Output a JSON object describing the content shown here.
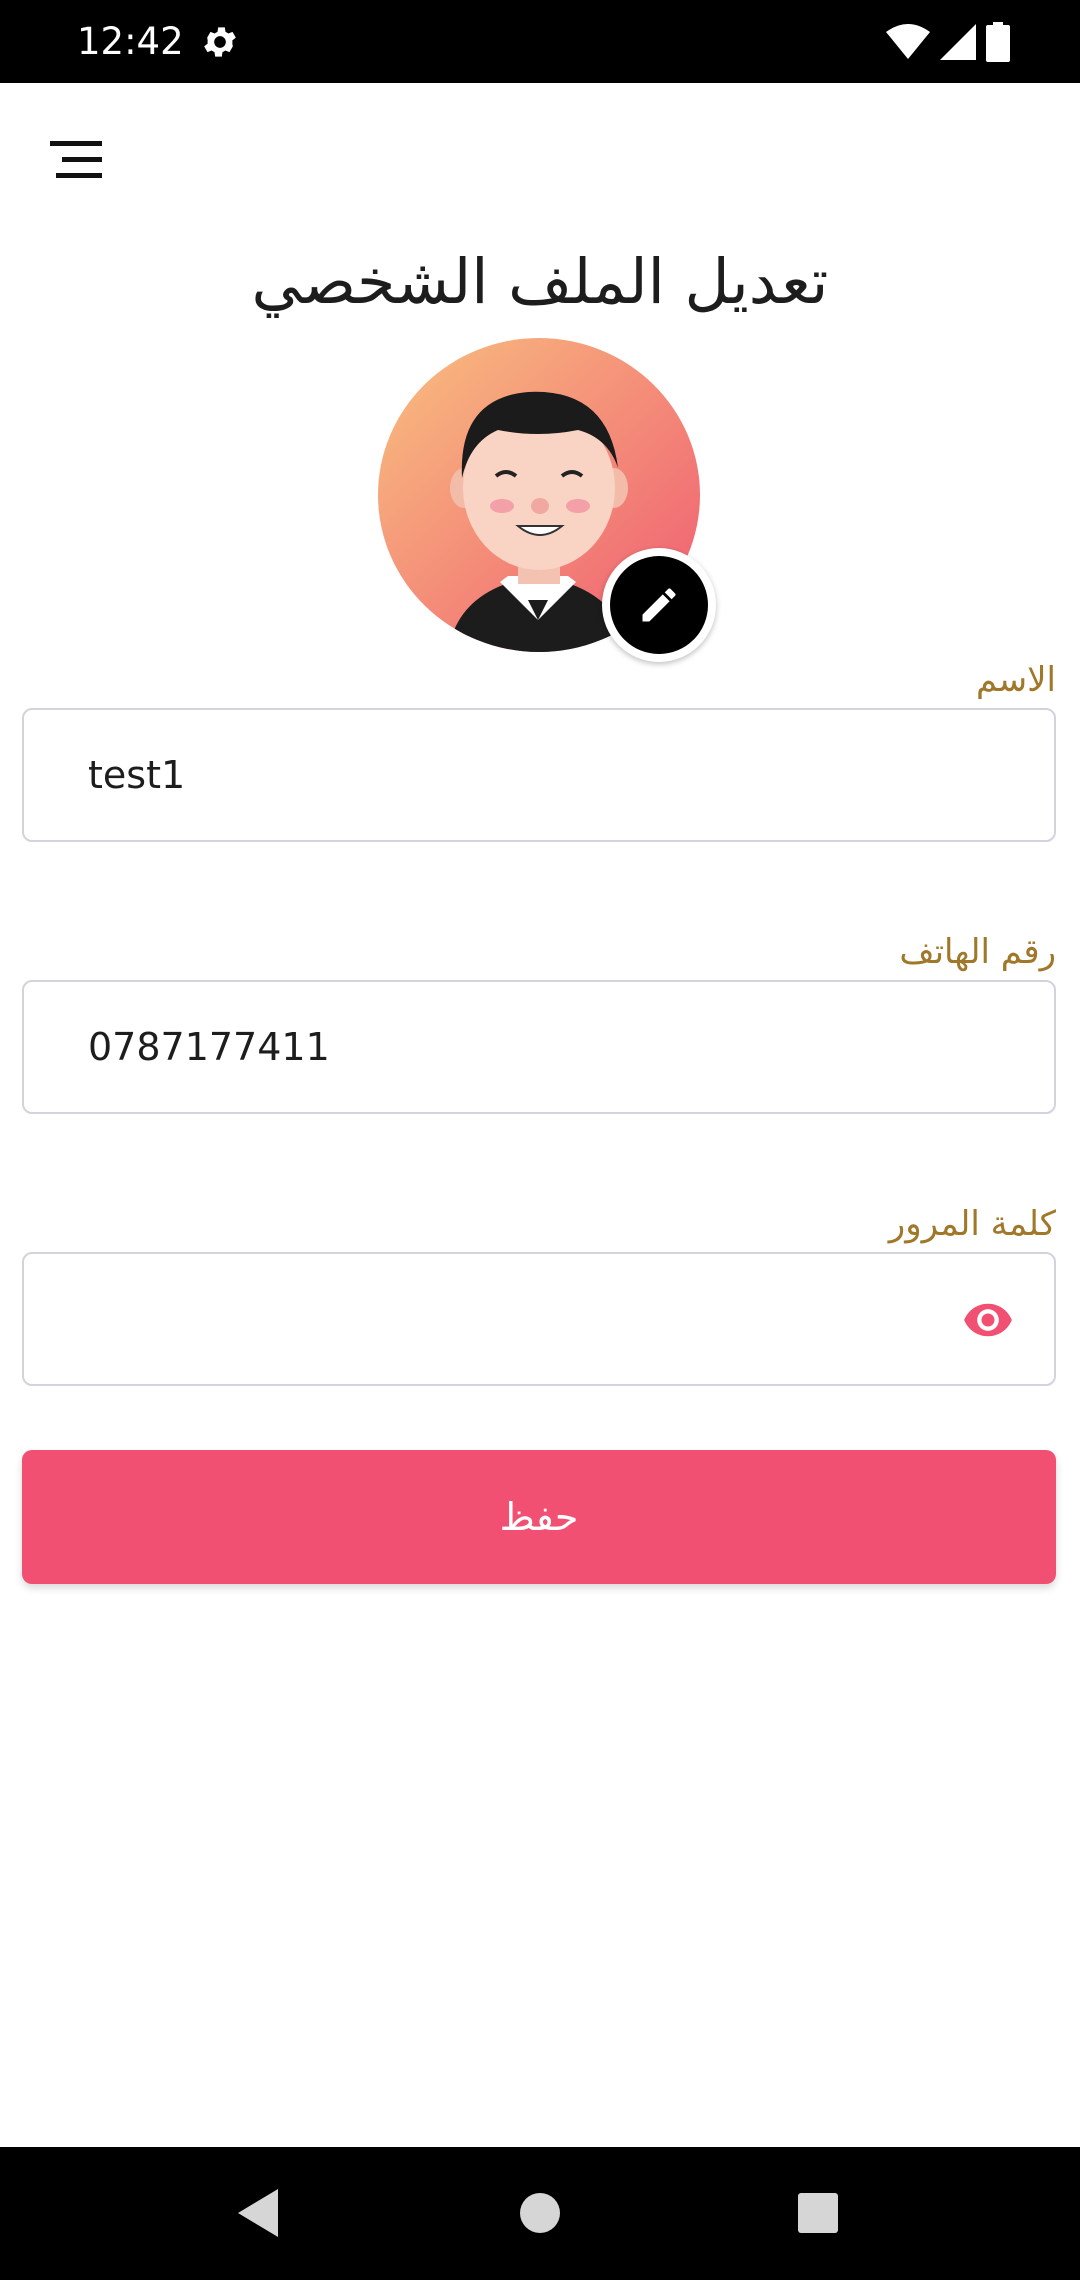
{
  "status_bar": {
    "time": "12:42",
    "icons": [
      "settings-icon",
      "wifi-icon",
      "signal-icon",
      "battery-icon"
    ]
  },
  "header": {
    "menu_icon": "menu-icon",
    "title": "تعديل الملف الشخصي"
  },
  "profile": {
    "avatar": "avatar-illustration",
    "edit_icon": "pencil-icon"
  },
  "form": {
    "name": {
      "label": "الاسم",
      "value": "test1"
    },
    "phone": {
      "label": "رقم الهاتف",
      "value": "0787177411"
    },
    "password": {
      "label": "كلمة المرور",
      "value": "",
      "toggle_icon": "eye-icon"
    },
    "save_label": "حفظ"
  },
  "colors": {
    "accent": "#f25073",
    "label": "#a0782a",
    "field_border": "#d3d3dc"
  },
  "nav_bar": {
    "icons": [
      "back-icon",
      "home-icon",
      "recents-icon"
    ]
  }
}
